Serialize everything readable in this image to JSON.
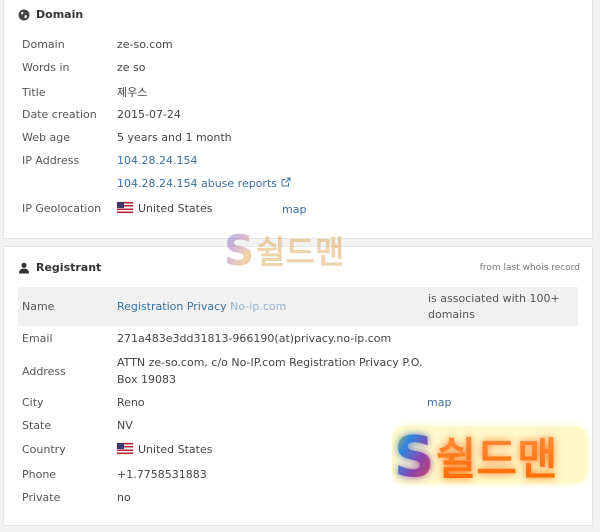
{
  "domain_panel": {
    "title": "Domain",
    "title_icon": "globe-icon",
    "rows": [
      {
        "label": "Domain",
        "value": "ze-so.com"
      },
      {
        "label": "Words in",
        "value": "ze so"
      },
      {
        "label": "Title",
        "value": "제우스"
      },
      {
        "label": "Date creation",
        "value": "2015-07-24"
      },
      {
        "label": "Web age",
        "value": "5 years and 1 month"
      },
      {
        "label": "IP Address",
        "value": "104.28.24.154"
      },
      {
        "label": "",
        "value": "104.28.24.154 abuse reports"
      },
      {
        "label": "IP Geolocation",
        "value": "United States"
      }
    ],
    "abuse_icon": "external-link-icon",
    "geo_flag": "us-flag-icon",
    "map_label": "map"
  },
  "registrant_panel": {
    "title": "Registrant",
    "title_icon": "user-icon",
    "note": "from last whois record",
    "name": {
      "label": "Name",
      "value": "Registration Privacy",
      "value_suffix": "No-ip.com",
      "association": "is associated with 100+ domains"
    },
    "rows": [
      {
        "label": "Email",
        "value": "271a483e3dd31813-966190(at)privacy.no-ip.com"
      },
      {
        "label": "Address",
        "value_line1": "ATTN ze-so.com, c/o No-IP.com Registration Privacy P.O.",
        "value_line2": "Box 19083"
      },
      {
        "label": "City",
        "value": "Reno"
      },
      {
        "label": "State",
        "value": "NV"
      },
      {
        "label": "Country",
        "value": "United States"
      },
      {
        "label": "Phone",
        "value": "+1.7758531883"
      },
      {
        "label": "Private",
        "value": "no"
      }
    ],
    "map_label": "map"
  },
  "watermark": {
    "text": "쉴드맨",
    "letter": "S"
  }
}
